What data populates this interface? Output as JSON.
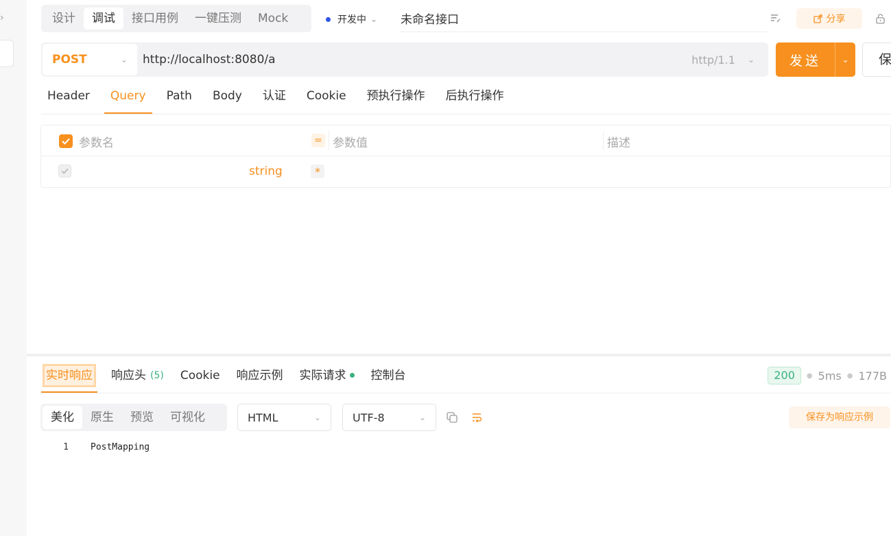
{
  "mode_tabs": [
    {
      "label": "设计",
      "active": false
    },
    {
      "label": "调试",
      "active": true
    },
    {
      "label": "接口用例",
      "active": false
    },
    {
      "label": "一键压测",
      "active": false
    },
    {
      "label": "Mock",
      "active": false
    }
  ],
  "environment": {
    "label": "开发中",
    "dot_color": "#2f54eb"
  },
  "api_name": "未命名接口",
  "header_actions": {
    "share_label": "分享"
  },
  "request": {
    "method": "POST",
    "url": "http://localhost:8080/a",
    "protocol": "http/1.1",
    "send_label": "发送",
    "save_label": "保"
  },
  "request_tabs": [
    {
      "label": "Header",
      "active": false
    },
    {
      "label": "Query",
      "active": true
    },
    {
      "label": "Path",
      "active": false
    },
    {
      "label": "Body",
      "active": false
    },
    {
      "label": "认证",
      "active": false
    },
    {
      "label": "Cookie",
      "active": false
    },
    {
      "label": "预执行操作",
      "active": false
    },
    {
      "label": "后执行操作",
      "active": false
    }
  ],
  "params_table": {
    "headers": {
      "name": "参数名",
      "value": "参数值",
      "desc": "描述"
    },
    "rows": [
      {
        "name": "",
        "type": "string",
        "required_mark": "*",
        "value": "",
        "desc": ""
      }
    ]
  },
  "response_tabs": [
    {
      "label": "实时响应",
      "active": true
    },
    {
      "label": "响应头",
      "count": "(5)",
      "active": false
    },
    {
      "label": "Cookie",
      "active": false
    },
    {
      "label": "响应示例",
      "active": false
    },
    {
      "label": "实际请求",
      "active": false
    },
    {
      "label": "控制台",
      "active": false
    }
  ],
  "response_meta": {
    "status": "200",
    "time": "5ms",
    "size": "177B"
  },
  "view_tabs": [
    {
      "label": "美化",
      "active": true
    },
    {
      "label": "原生",
      "active": false
    },
    {
      "label": "预览",
      "active": false
    },
    {
      "label": "可视化",
      "active": false
    }
  ],
  "format_select": "HTML",
  "encoding_select": "UTF-8",
  "save_example_label": "保存为响应示例",
  "response_body": [
    {
      "line": "1",
      "text": "PostMapping"
    }
  ],
  "colors": {
    "accent": "#f7901e",
    "success": "#3bb07f"
  }
}
